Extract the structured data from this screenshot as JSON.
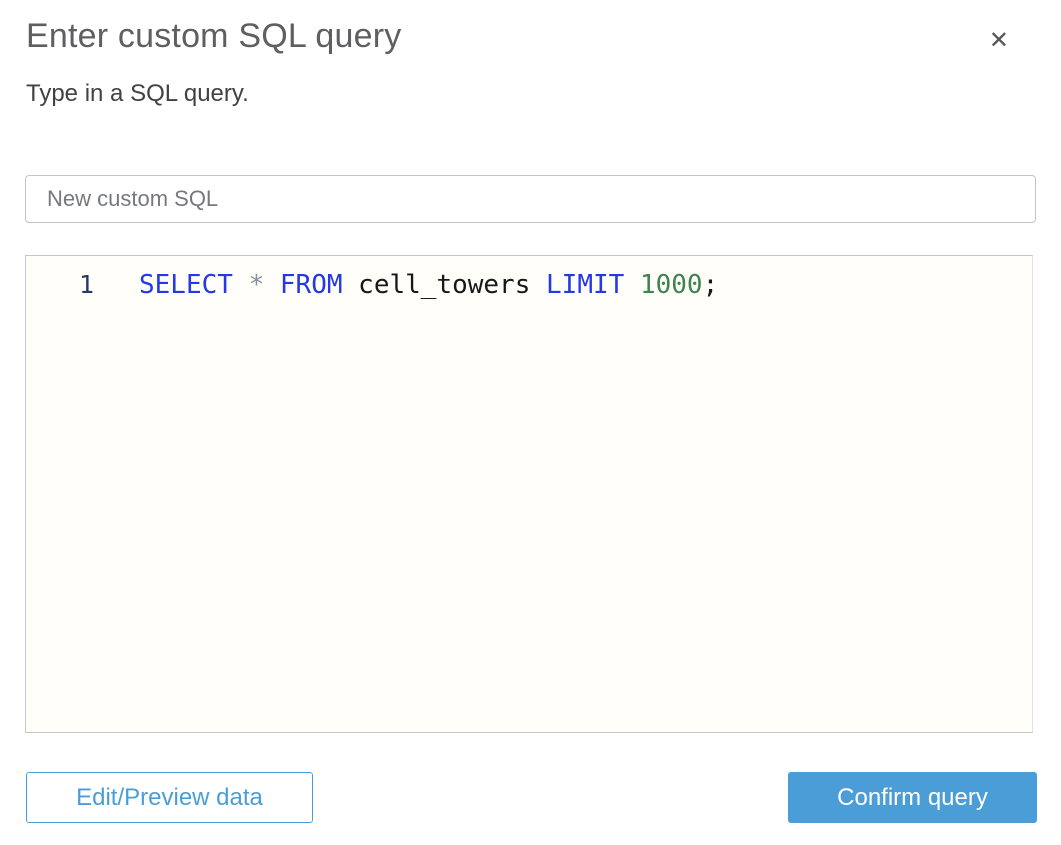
{
  "dialog": {
    "title": "Enter custom SQL query",
    "subtitle": "Type in a SQL query.",
    "close_glyph": "✕"
  },
  "name_input": {
    "value": "New custom SQL"
  },
  "editor": {
    "line_number": "1",
    "query_text": "SELECT * FROM cell_towers LIMIT 1000;",
    "tokens": [
      {
        "text": "SELECT",
        "type": "keyword"
      },
      {
        "text": " ",
        "type": "plain"
      },
      {
        "text": "*",
        "type": "operator"
      },
      {
        "text": " ",
        "type": "plain"
      },
      {
        "text": "FROM",
        "type": "keyword"
      },
      {
        "text": " ",
        "type": "plain"
      },
      {
        "text": "cell_towers",
        "type": "identifier"
      },
      {
        "text": " ",
        "type": "plain"
      },
      {
        "text": "LIMIT",
        "type": "keyword"
      },
      {
        "text": " ",
        "type": "plain"
      },
      {
        "text": "1000",
        "type": "number"
      },
      {
        "text": ";",
        "type": "punct"
      }
    ]
  },
  "buttons": {
    "edit_preview": "Edit/Preview data",
    "confirm": "Confirm query"
  },
  "colors": {
    "accent": "#4b9dd8",
    "keyword": "#2438e8",
    "number": "#3e8450",
    "operator": "#8491a0",
    "ident": "#17181c",
    "linenum": "#233a68",
    "editor-bg": "#fffef8"
  }
}
